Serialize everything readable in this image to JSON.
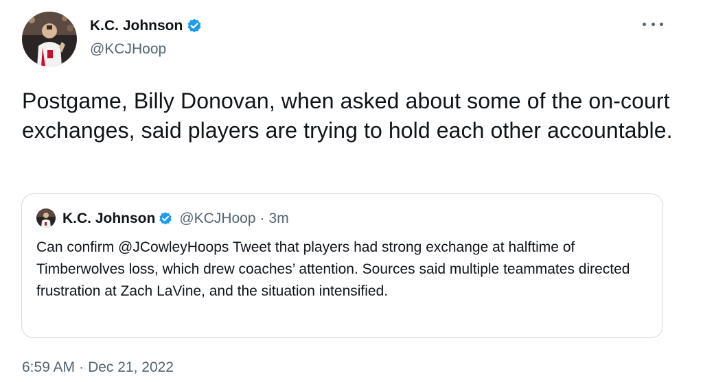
{
  "author": {
    "name": "K.C. Johnson",
    "handle": "@KCJHoop"
  },
  "tweet": {
    "text": "Postgame, Billy Donovan, when asked about some of the on-court exchanges, said players are trying to hold each other accountable."
  },
  "quoted_tweet": {
    "name": "K.C. Johnson",
    "handle": "@KCJHoop",
    "separator": "·",
    "time": "3m",
    "text": "Can confirm @JCowleyHoops Tweet that players had strong exchange at halftime of Timberwolves loss, which drew coaches’ attention. Sources said multiple teammates directed frustration at Zach LaVine, and the situation intensified."
  },
  "timestamp": {
    "time": "6:59 AM",
    "separator": "·",
    "date": "Dec 21, 2022"
  },
  "icons": {
    "verified": "verified-badge-icon",
    "more": "more-options-icon"
  },
  "colors": {
    "verified": "#1d9bf0",
    "text_primary": "#0f1419",
    "text_secondary": "#536471",
    "border": "#d3dadf"
  }
}
